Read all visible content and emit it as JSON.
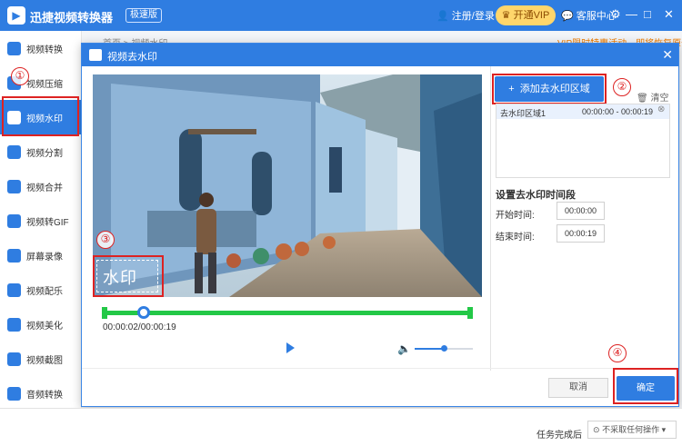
{
  "app": {
    "title": "迅捷视频转换器",
    "edition": "极速版",
    "login": "注册/登录",
    "vip": "开通VIP",
    "service": "客服中心",
    "controls": [
      "⚙",
      "—",
      "□",
      "✕"
    ]
  },
  "sidebar": {
    "items": [
      {
        "label": "视频转换",
        "icon": "video-convert-icon",
        "active": false
      },
      {
        "label": "视频压缩",
        "icon": "video-compress-icon",
        "active": false
      },
      {
        "label": "视频水印",
        "icon": "video-watermark-icon",
        "active": true
      },
      {
        "label": "视频分割",
        "icon": "video-split-icon",
        "active": false
      },
      {
        "label": "视频合并",
        "icon": "video-merge-icon",
        "active": false
      },
      {
        "label": "视频转GIF",
        "icon": "video-gif-icon",
        "active": false
      },
      {
        "label": "屏幕录像",
        "icon": "screen-record-icon",
        "active": false
      },
      {
        "label": "视频配乐",
        "icon": "video-music-icon",
        "active": false
      },
      {
        "label": "视频美化",
        "icon": "video-beautify-icon",
        "active": false
      },
      {
        "label": "视频截图",
        "icon": "video-screenshot-icon",
        "active": false
      },
      {
        "label": "音频转换",
        "icon": "audio-convert-icon",
        "active": false
      }
    ]
  },
  "background": {
    "breadcrumb": "首页 > 视频水印",
    "promo": "VIP限时特惠活动，即将恢复原价"
  },
  "dialog": {
    "title": "视频去水印",
    "close": "✕",
    "watermark_text": "水印",
    "current_time": "00:00:02/00:00:19",
    "progress": 0.105,
    "volume": 0.5,
    "add_region": "添加去水印区域",
    "add_region_plus": "+",
    "clear": "清空",
    "regions": [
      {
        "name": "去水印区域1",
        "time": "00:00:00 - 00:00:19"
      }
    ],
    "time_section_title": "设置去水印时间段",
    "start_label": "开始时间:",
    "start_value": "00:00:00",
    "end_label": "结束时间:",
    "end_value": "00:00:19",
    "cancel": "取消",
    "ok": "确定"
  },
  "bottom": {
    "after_label": "任务完成后",
    "after_value": "不采取任何操作"
  },
  "steps": [
    "①",
    "②",
    "③",
    "④"
  ],
  "colors": {
    "accent": "#2f7de1",
    "marker": "#dd2222",
    "timeline": "#23c847"
  }
}
